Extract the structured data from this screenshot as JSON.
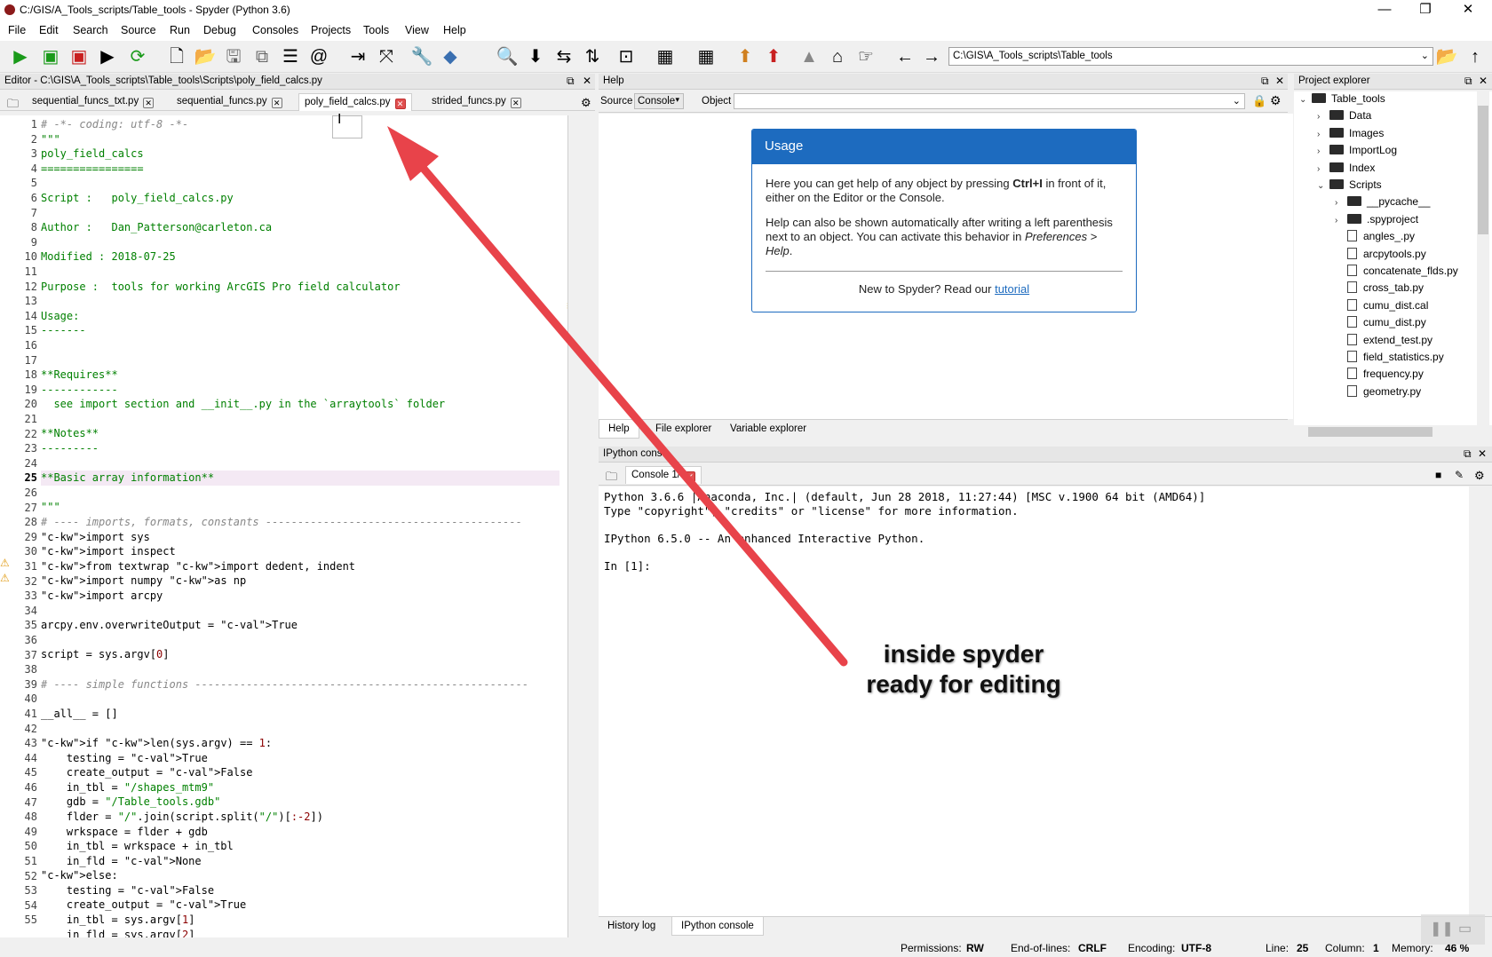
{
  "window": {
    "title": "C:/GIS/A_Tools_scripts/Table_tools - Spyder (Python 3.6)",
    "controls": [
      "—",
      "❐",
      "✕"
    ]
  },
  "menu": [
    "File",
    "Edit",
    "Search",
    "Source",
    "Run",
    "Debug",
    "Consoles",
    "Projects",
    "Tools",
    "View",
    "Help"
  ],
  "toolbar": {
    "path": "C:\\GIS\\A_Tools_scripts\\Table_tools"
  },
  "editor": {
    "pane_title": "Editor - C:\\GIS\\A_Tools_scripts\\Table_tools\\Scripts\\poly_field_calcs.py",
    "tabs": [
      {
        "label": "sequential_funcs_txt.py",
        "active": false
      },
      {
        "label": "sequential_funcs.py",
        "active": false
      },
      {
        "label": "poly_field_calcs.py",
        "active": true
      },
      {
        "label": "strided_funcs.py",
        "active": false
      }
    ],
    "lines": [
      {
        "n": "1",
        "t": "# -*- coding: utf-8 -*-",
        "c": "c-com"
      },
      {
        "n": "2",
        "t": "\"\"\"",
        "c": "c-str"
      },
      {
        "n": "3",
        "t": "poly_field_calcs",
        "c": "c-str"
      },
      {
        "n": "4",
        "t": "================",
        "c": "c-str"
      },
      {
        "n": "5",
        "t": "",
        "c": ""
      },
      {
        "n": "6",
        "t": "Script :   poly_field_calcs.py",
        "c": "c-str"
      },
      {
        "n": "7",
        "t": "",
        "c": ""
      },
      {
        "n": "8",
        "t": "Author :   Dan_Patterson@carleton.ca",
        "c": "c-str"
      },
      {
        "n": "9",
        "t": "",
        "c": ""
      },
      {
        "n": "10",
        "t": "Modified : 2018-07-25",
        "c": "c-str"
      },
      {
        "n": "11",
        "t": "",
        "c": ""
      },
      {
        "n": "12",
        "t": "Purpose :  tools for working ArcGIS Pro field calculator",
        "c": "c-str"
      },
      {
        "n": "13",
        "t": "",
        "c": ""
      },
      {
        "n": "14",
        "t": "Usage:",
        "c": "c-str"
      },
      {
        "n": "15",
        "t": "-------",
        "c": "c-str"
      },
      {
        "n": "16",
        "t": "",
        "c": ""
      },
      {
        "n": "17",
        "t": "",
        "c": ""
      },
      {
        "n": "18",
        "t": "**Requires**",
        "c": "c-str"
      },
      {
        "n": "19",
        "t": "------------",
        "c": "c-str"
      },
      {
        "n": "20",
        "t": "  see import section and __init__.py in the `arraytools` folder",
        "c": "c-str"
      },
      {
        "n": "21",
        "t": "",
        "c": ""
      },
      {
        "n": "22",
        "t": "**Notes**",
        "c": "c-str"
      },
      {
        "n": "23",
        "t": "---------",
        "c": "c-str"
      },
      {
        "n": "24",
        "t": "",
        "c": ""
      },
      {
        "n": "25",
        "t": "**Basic array information**",
        "c": "c-str hl"
      },
      {
        "n": "26",
        "t": "",
        "c": ""
      },
      {
        "n": "27",
        "t": "\"\"\"",
        "c": "c-str"
      },
      {
        "n": "28",
        "t": "# ---- imports, formats, constants ----------------------------------------",
        "c": "c-com"
      },
      {
        "n": "29",
        "t": "import sys",
        "c": "kw1"
      },
      {
        "n": "30",
        "t": "import inspect",
        "c": "kw1"
      },
      {
        "n": "31",
        "t": "from textwrap import dedent, indent",
        "c": "kw2"
      },
      {
        "n": "32",
        "t": "import numpy as np",
        "c": "kw3"
      },
      {
        "n": "33",
        "t": "import arcpy",
        "c": "kw1"
      },
      {
        "n": "34",
        "t": "",
        "c": ""
      },
      {
        "n": "35",
        "t": "arcpy.env.overwriteOutput = True",
        "c": "val"
      },
      {
        "n": "36",
        "t": "",
        "c": ""
      },
      {
        "n": "37",
        "t": "script = sys.argv[0]",
        "c": "num"
      },
      {
        "n": "38",
        "t": "",
        "c": ""
      },
      {
        "n": "39",
        "t": "# ---- simple functions ----------------------------------------------------",
        "c": "c-com"
      },
      {
        "n": "40",
        "t": "",
        "c": ""
      },
      {
        "n": "41",
        "t": "__all__ = []",
        "c": ""
      },
      {
        "n": "42",
        "t": "",
        "c": ""
      },
      {
        "n": "43",
        "t": "if len(sys.argv) == 1:",
        "c": "if"
      },
      {
        "n": "44",
        "t": "    testing = True",
        "c": "val"
      },
      {
        "n": "45",
        "t": "    create_output = False",
        "c": "val"
      },
      {
        "n": "46",
        "t": "    in_tbl = \"/shapes_mtm9\"",
        "c": "s"
      },
      {
        "n": "47",
        "t": "    gdb = \"/Table_tools.gdb\"",
        "c": "s"
      },
      {
        "n": "48",
        "t": "    flder = \"/\".join(script.split(\"/\")[:-2])",
        "c": ""
      },
      {
        "n": "49",
        "t": "    wrkspace = flder + gdb",
        "c": ""
      },
      {
        "n": "50",
        "t": "    in_tbl = wrkspace + in_tbl",
        "c": ""
      },
      {
        "n": "51",
        "t": "    in_fld = None",
        "c": "val"
      },
      {
        "n": "52",
        "t": "else:",
        "c": "else"
      },
      {
        "n": "53",
        "t": "    testing = False",
        "c": "val"
      },
      {
        "n": "54",
        "t": "    create_output = True",
        "c": "val"
      },
      {
        "n": "55",
        "t": "    in_tbl = sys.argv[1]",
        "c": "num"
      },
      {
        "n": "",
        "t": "    in_fld = sys.argv[2]",
        "c": "num"
      }
    ]
  },
  "help": {
    "pane_title": "Help",
    "source_label": "Source",
    "source_value": "Console",
    "object_label": "Object",
    "usage_title": "Usage",
    "usage_p1a": "Here you can get help of any object by pressing ",
    "usage_p1b": "Ctrl+I",
    "usage_p1c": " in front of it, either on the Editor or the Console.",
    "usage_p2a": "Help can also be shown automatically after writing a left parenthesis next to an object. You can activate this behavior in ",
    "usage_p2b": "Preferences > Help",
    "usage_p2c": ".",
    "usage_p3": "New to Spyder? Read our ",
    "usage_link": "tutorial",
    "tabs": [
      "Help",
      "File explorer",
      "Variable explorer"
    ]
  },
  "project": {
    "pane_title": "Project explorer",
    "tree": [
      {
        "label": "Table_tools",
        "type": "folder",
        "depth": 0,
        "exp": "v"
      },
      {
        "label": "Data",
        "type": "folder",
        "depth": 1,
        "exp": ">"
      },
      {
        "label": "Images",
        "type": "folder",
        "depth": 1,
        "exp": ">"
      },
      {
        "label": "ImportLog",
        "type": "folder",
        "depth": 1,
        "exp": ">"
      },
      {
        "label": "Index",
        "type": "folder",
        "depth": 1,
        "exp": ">"
      },
      {
        "label": "Scripts",
        "type": "folder",
        "depth": 1,
        "exp": "v"
      },
      {
        "label": "__pycache__",
        "type": "folder",
        "depth": 2,
        "exp": ">"
      },
      {
        "label": ".spyproject",
        "type": "folder",
        "depth": 2,
        "exp": ">"
      },
      {
        "label": "angles_.py",
        "type": "file",
        "depth": 2,
        "exp": ""
      },
      {
        "label": "arcpytools.py",
        "type": "file",
        "depth": 2,
        "exp": ""
      },
      {
        "label": "concatenate_flds.py",
        "type": "file",
        "depth": 2,
        "exp": ""
      },
      {
        "label": "cross_tab.py",
        "type": "file",
        "depth": 2,
        "exp": ""
      },
      {
        "label": "cumu_dist.cal",
        "type": "file",
        "depth": 2,
        "exp": ""
      },
      {
        "label": "cumu_dist.py",
        "type": "file",
        "depth": 2,
        "exp": ""
      },
      {
        "label": "extend_test.py",
        "type": "file",
        "depth": 2,
        "exp": ""
      },
      {
        "label": "field_statistics.py",
        "type": "file",
        "depth": 2,
        "exp": ""
      },
      {
        "label": "frequency.py",
        "type": "file",
        "depth": 2,
        "exp": ""
      },
      {
        "label": "geometry.py",
        "type": "file",
        "depth": 2,
        "exp": ""
      }
    ]
  },
  "console": {
    "pane_title": "IPython cons",
    "tab_label": "Console 1/",
    "lines": [
      "Python 3.6.6 |Anaconda, Inc.| (default, Jun 28 2018, 11:27:44) [MSC v.1900 64 bit (AMD64)]",
      "Type \"copyright\", \"credits\" or \"license\" for more information.",
      "",
      "IPython 6.5.0 -- An enhanced Interactive Python.",
      "",
      "In [1]:"
    ],
    "tabs": [
      "History log",
      "IPython console"
    ]
  },
  "status": {
    "permissions_label": "Permissions:",
    "permissions": "RW",
    "eol_label": "End-of-lines:",
    "eol": "CRLF",
    "encoding_label": "Encoding:",
    "encoding": "UTF-8",
    "line_label": "Line:",
    "line": "25",
    "column_label": "Column:",
    "column": "1",
    "memory_label": "Memory:",
    "memory": "46 %"
  },
  "annotation": {
    "line1": "inside spyder",
    "line2": "ready for editing",
    "color": "#e8434a"
  }
}
